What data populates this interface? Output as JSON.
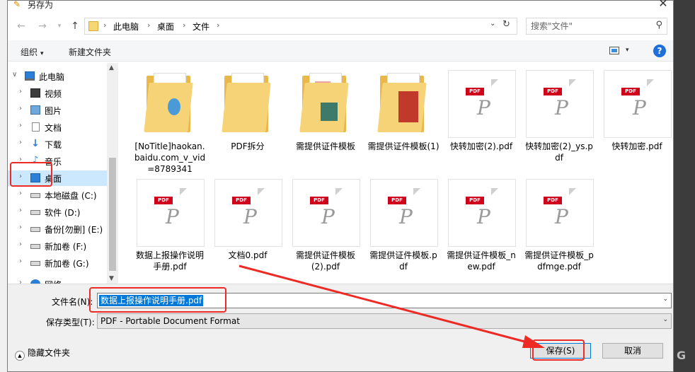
{
  "window": {
    "title": "另存为",
    "close_glyph": "✕"
  },
  "nav_buttons": {
    "back": "←",
    "forward": "→",
    "up": "↑"
  },
  "address": {
    "crumbs": [
      "此电脑",
      "桌面",
      "文件"
    ],
    "separator": "›",
    "drop_glyph": "⌄",
    "refresh_glyph": "↻"
  },
  "search": {
    "placeholder": "搜索\"文件\"",
    "icon_glyph": "⚲"
  },
  "toolbar": {
    "organize": "组织",
    "new_folder": "新建文件夹",
    "caret": "▾",
    "help": "?"
  },
  "nav_pane": {
    "items": [
      {
        "label": "此电脑",
        "icon": "computer-icon",
        "chev": "∨"
      },
      {
        "label": "视频",
        "icon": "video-icon",
        "chev": "›"
      },
      {
        "label": "图片",
        "icon": "pictures-icon",
        "chev": "›"
      },
      {
        "label": "文档",
        "icon": "documents-icon",
        "chev": "›"
      },
      {
        "label": "下载",
        "icon": "download-icon",
        "chev": "›",
        "glyph": "↓"
      },
      {
        "label": "音乐",
        "icon": "music-icon",
        "chev": "›",
        "glyph": "♪"
      },
      {
        "label": "桌面",
        "icon": "desktop-icon",
        "chev": "›",
        "selected": true
      },
      {
        "label": "本地磁盘 (C:)",
        "icon": "drive-icon",
        "chev": "›"
      },
      {
        "label": "软件 (D:)",
        "icon": "drive-icon",
        "chev": "›"
      },
      {
        "label": "备份[勿删] (E:)",
        "icon": "drive-icon",
        "chev": "›"
      },
      {
        "label": "新加卷 (F:)",
        "icon": "drive-icon",
        "chev": "›"
      },
      {
        "label": "新加卷 (G:)",
        "icon": "drive-icon",
        "chev": "›"
      },
      {
        "label": "网络",
        "icon": "network-icon",
        "chev": "›"
      }
    ],
    "scroll_up": "▲",
    "scroll_down": "▼"
  },
  "files": [
    {
      "name": "[NoTitle]haokan.baidu.com_v_vid=8789341",
      "kind": "folder"
    },
    {
      "name": "PDF拆分",
      "kind": "folder"
    },
    {
      "name": "需提供证件模板",
      "kind": "folder"
    },
    {
      "name": "需提供证件模板(1)",
      "kind": "folder"
    },
    {
      "name": "快转加密(2).pdf",
      "kind": "pdf"
    },
    {
      "name": "快转加密(2)_ys.pdf",
      "kind": "pdf"
    },
    {
      "name": "快转加密.pdf",
      "kind": "pdf"
    },
    {
      "name": "数据上报操作说明手册.pdf",
      "kind": "pdf"
    },
    {
      "name": "文档0.pdf",
      "kind": "pdf"
    },
    {
      "name": "需提供证件模板(2).pdf",
      "kind": "pdf"
    },
    {
      "name": "需提供证件模板.pdf",
      "kind": "pdf"
    },
    {
      "name": "需提供证件模板_new.pdf",
      "kind": "pdf"
    },
    {
      "name": "需提供证件模板_pdfmge.pdf",
      "kind": "pdf"
    }
  ],
  "pdf_badge": "PDF",
  "pdf_glyph": "P",
  "form": {
    "filename_label": "文件名(N):",
    "filename_value": "数据上报操作说明手册.pdf",
    "filetype_label": "保存类型(T):",
    "filetype_value": "PDF - Portable Document Format",
    "drop_glyph": "⌄",
    "hide_folders": "隐藏文件夹",
    "hide_glyph": "▲",
    "save": "保存(S)",
    "cancel": "取消"
  },
  "background": {
    "right_letter": "G"
  },
  "colors": {
    "accent": "#0078d7",
    "annotation": "#ee2a24",
    "selected_nav": "#cce8ff",
    "folder": "#f6d376",
    "pdf_red": "#d0021b"
  }
}
